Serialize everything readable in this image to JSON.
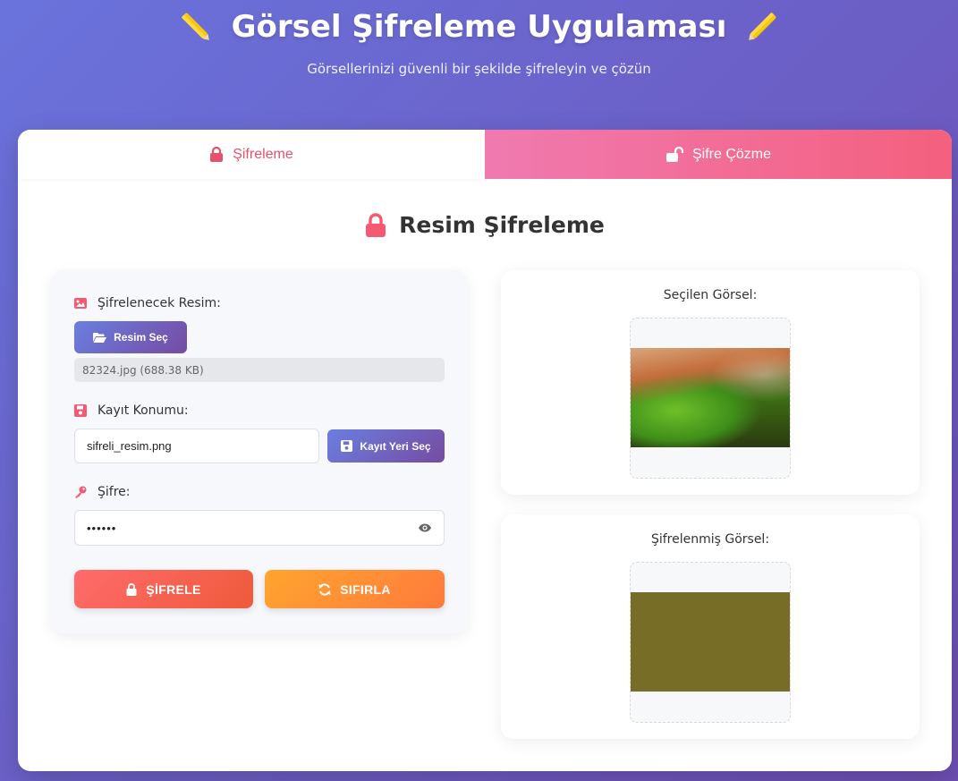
{
  "header": {
    "title": "Görsel Şifreleme Uygulaması",
    "subtitle": "Görsellerinizi güvenli bir şekilde şifreleyin ve çözün"
  },
  "tabs": [
    {
      "label": "Şifreleme",
      "icon": "lock-icon",
      "active": true
    },
    {
      "label": "Şifre Çözme",
      "icon": "unlock-icon",
      "active": false
    }
  ],
  "section": {
    "title": "Resim Şifreleme",
    "icon": "lock-icon"
  },
  "form": {
    "image_label": "Şifrelenecek Resim:",
    "select_image_button": "Resim Seç",
    "file_info": "82324.jpg (688.38 KB)",
    "save_label": "Kayıt Konumu:",
    "save_path_value": "sifreli_resim.png",
    "save_location_button": "Kayıt Yeri Seç",
    "password_label": "Şifre:",
    "password_value": "••••••",
    "encrypt_button": "ŞİFRELE",
    "reset_button": "SIFIRLA"
  },
  "previews": {
    "selected_title": "Seçilen Görsel:",
    "encrypted_title": "Şifrelenmiş Görsel:"
  },
  "colors": {
    "accent": "#e8506c",
    "primary_gradient_start": "#6a7fe0",
    "primary_gradient_end": "#764ba2",
    "encrypt": "#ff6b6b",
    "reset": "#ffa52e",
    "encrypted_image": "#776d26"
  }
}
